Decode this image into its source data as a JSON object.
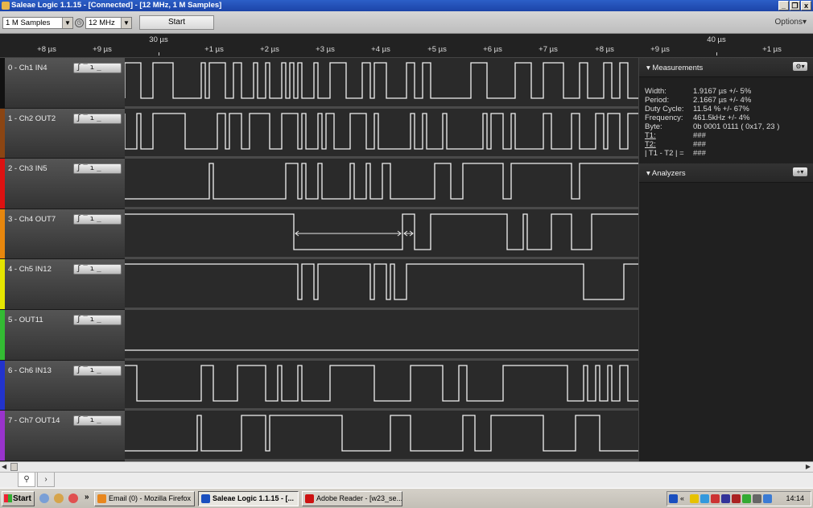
{
  "window": {
    "title": "Saleae Logic 1.1.15 - [Connected] - [12 MHz, 1 M Samples]",
    "buttons": [
      "_",
      "&#",
      "x"
    ]
  },
  "toolbar": {
    "samples_value": "1 M Samples",
    "freq_value": "12 MHz",
    "start_label": "Start",
    "options_label": "Options▾"
  },
  "ruler": {
    "major_labels": [
      {
        "text": "30 µs",
        "at": 197
      },
      {
        "text": "40 µs",
        "at": 890
      }
    ],
    "minor_labels": [
      {
        "text": "+8 µs",
        "at": 58
      },
      {
        "text": "+9 µs",
        "at": 127
      },
      {
        "text": "+1 µs",
        "at": 266
      },
      {
        "text": "+2 µs",
        "at": 335
      },
      {
        "text": "+3 µs",
        "at": 404
      },
      {
        "text": "+4 µs",
        "at": 473
      },
      {
        "text": "+5 µs",
        "at": 543
      },
      {
        "text": "+6 µs",
        "at": 612
      },
      {
        "text": "+7 µs",
        "at": 681
      },
      {
        "text": "+8 µs",
        "at": 751
      },
      {
        "text": "+9 µs",
        "at": 820
      },
      {
        "text": "+1 µs",
        "at": 959
      }
    ]
  },
  "channels": [
    {
      "name": "0 - Ch1 IN4",
      "color": "#111111",
      "trigger": "ʃ‾ɿ_",
      "edges": [
        0,
        20,
        35,
        60,
        95,
        100,
        105,
        125,
        135,
        145,
        160,
        165,
        175,
        180,
        195,
        200,
        205,
        210,
        215,
        220,
        235,
        240,
        255,
        275,
        295,
        305,
        310,
        325,
        350,
        360,
        370,
        380,
        430,
        450,
        485,
        505,
        520,
        545,
        565,
        575,
        595,
        605,
        615,
        625
      ],
      "start_high": false
    },
    {
      "name": "1 - Ch2 OUT2",
      "color": "#8b4513",
      "trigger": "ʃ‾ɿ_",
      "edges": [
        0,
        15,
        20,
        35,
        75,
        115,
        125,
        130,
        145,
        155,
        180,
        195,
        215,
        220,
        225,
        240,
        245,
        250,
        260,
        280,
        300,
        310,
        315,
        355,
        360,
        370,
        375,
        395,
        400,
        445,
        450,
        455,
        470,
        480,
        485,
        520,
        530,
        555,
        565,
        585,
        595,
        600,
        615,
        625
      ],
      "start_high": true
    },
    {
      "name": "2 - Ch3 IN5",
      "color": "#dd1111",
      "trigger": "ʃ‾ɿ_",
      "edges": [
        105,
        110,
        200,
        215,
        220,
        225,
        240,
        245,
        280,
        285,
        300,
        305,
        320,
        330,
        385,
        405,
        420,
        470,
        480,
        555,
        565
      ],
      "start_high": false
    },
    {
      "name": "3 - Ch4 OUT7",
      "color": "#e8870d",
      "trigger": "ʃ‾ɿ_",
      "edges": [
        210,
        345,
        360,
        380,
        475,
        495,
        500,
        530,
        555,
        580
      ],
      "start_high": true
    },
    {
      "name": "4 - Ch5 IN12",
      "color": "#e6e600",
      "trigger": "ʃ‾ɿ_",
      "edges": [
        215,
        220,
        235,
        240,
        305,
        310,
        325,
        330,
        335,
        350,
        570,
        620
      ],
      "start_high": true
    },
    {
      "name": "5 - OUT11",
      "color": "#33bb33",
      "trigger": "ʃ‾ɿ_",
      "edges": [],
      "start_high": false
    },
    {
      "name": "6 - Ch6 IN13",
      "color": "#2233cc",
      "trigger": "ʃ‾ɿ_",
      "edges": [
        15,
        95,
        110,
        140,
        175,
        190,
        195,
        215,
        220,
        255,
        310,
        355,
        395,
        415,
        425,
        470,
        550,
        570,
        575,
        585,
        590,
        600,
        605,
        615,
        625
      ],
      "start_high": true
    },
    {
      "name": "7 - Ch7 OUT14",
      "color": "#9933cc",
      "trigger": "ʃ‾ɿ_",
      "edges": [
        90,
        95,
        145,
        175,
        180,
        270,
        330,
        355,
        420,
        435,
        455,
        520,
        560,
        590
      ],
      "start_high": false
    }
  ],
  "measurement_arrow": {
    "channel": 3,
    "from": 210,
    "to": 345,
    "to2": 360
  },
  "measurements": {
    "title": "Measurements",
    "rows": [
      {
        "label": "Width:",
        "value": "1.9167 µs +/- 5%"
      },
      {
        "label": "Period:",
        "value": "2.1667 µs +/- 4%"
      },
      {
        "label": "Duty Cycle:",
        "value": "11.54 % +/- 67%"
      },
      {
        "label": "Frequency:",
        "value": "461.5kHz +/- 4%"
      },
      {
        "label": "Byte:",
        "value": "0b  0001  0111  ( 0x17, 23 )"
      },
      {
        "label": "T1:",
        "value": "###",
        "underline": true
      },
      {
        "label": "T2:",
        "value": "###",
        "underline": true
      },
      {
        "label": "| T1 - T2 | =",
        "value": "###"
      }
    ]
  },
  "analyzers": {
    "title": "Analyzers"
  },
  "taskbar": {
    "start_label": "Start",
    "chevron": "»",
    "tasks": [
      {
        "label": "Email (0) - Mozilla Firefox",
        "color": "#e8871e"
      },
      {
        "label": "Saleae Logic 1.1.15 - [...",
        "color": "#1a4fbf",
        "active": true
      },
      {
        "label": "Adobe Reader - [w23_se...",
        "color": "#cc1111"
      }
    ],
    "clock": "14:14"
  }
}
